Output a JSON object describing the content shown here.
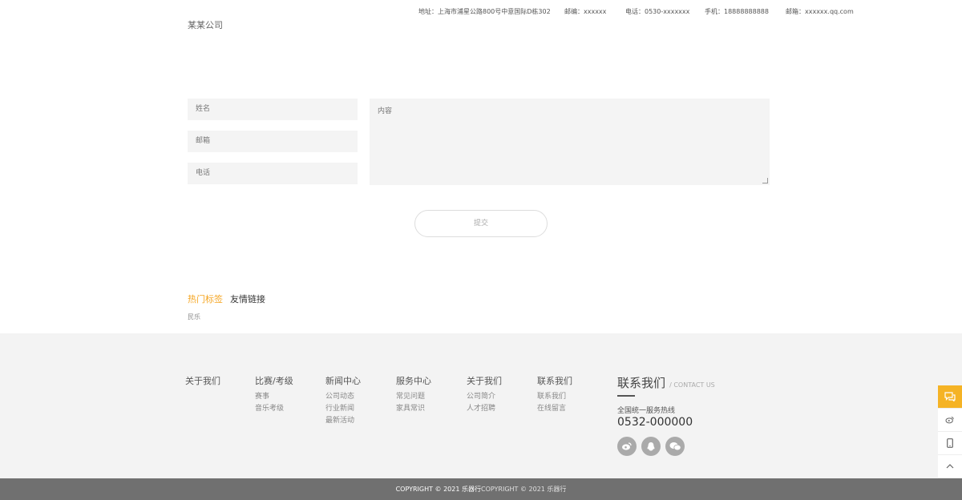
{
  "header": {
    "address": "地址：上海市浦星公路800号中意国际D栋302",
    "postcode": "邮编：xxxxxx",
    "phone": "电话：0530-xxxxxxx",
    "mobile": "手机：18888888888",
    "email": "邮箱：xxxxxx.qq.com",
    "company": "某某公司"
  },
  "form": {
    "name_placeholder": "姓名",
    "email_placeholder": "邮箱",
    "phone_placeholder": "电话",
    "content_placeholder": "内容",
    "submit_label": "提交"
  },
  "tags": {
    "tab_hot": "热门标签",
    "tab_links": "友情链接",
    "items": [
      "民乐"
    ]
  },
  "footer": {
    "columns": [
      {
        "title": "关于我们",
        "links": []
      },
      {
        "title": "比赛/考级",
        "links": [
          "赛事",
          "音乐考级"
        ]
      },
      {
        "title": "新闻中心",
        "links": [
          "公司动态",
          "行业新闻",
          "最新活动"
        ]
      },
      {
        "title": "服务中心",
        "links": [
          "常见问题",
          "家具常识"
        ]
      },
      {
        "title": "关于我们",
        "links": [
          "公司简介",
          "人才招聘"
        ]
      },
      {
        "title": "联系我们",
        "links": [
          "联系我们",
          "在线留言"
        ]
      }
    ],
    "contact": {
      "title": "联系我们",
      "subtitle": "/ CONTACT US",
      "hotline_label": "全国统一服务热线",
      "hotline": "0532-000000"
    },
    "copyright_main": "COPYRIGHT © 2021 乐器行",
    "copyright_dup": "COPYRIGHT © 2021 乐器行"
  },
  "colors": {
    "accent": "#f5a623",
    "footer_bg": "#f3f3f3",
    "bottom_bar": "#707070"
  },
  "icons": {
    "social": [
      "weibo-icon",
      "qq-icon",
      "wechat-icon"
    ],
    "sidebar": [
      "chat-icon",
      "weibo-icon",
      "mobile-icon",
      "back-to-top-icon"
    ]
  }
}
